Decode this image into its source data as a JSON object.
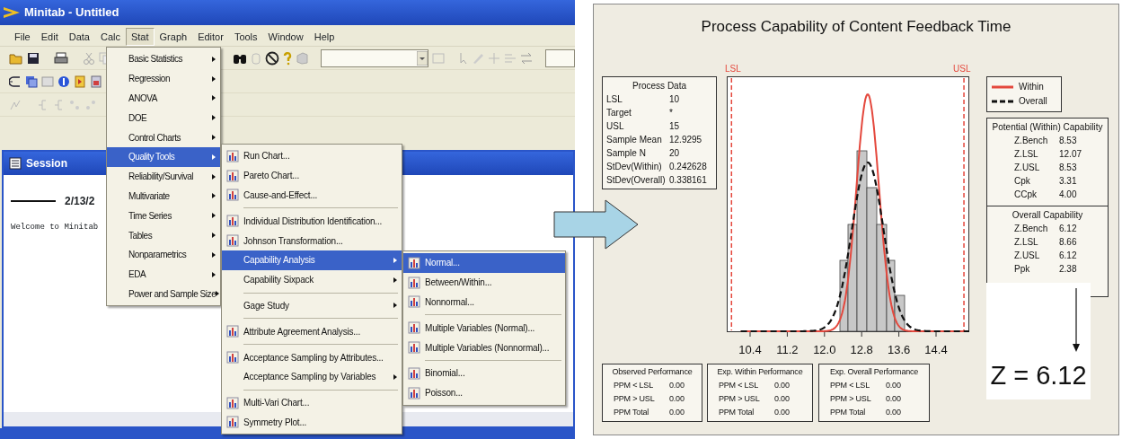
{
  "window": {
    "title": "Minitab - Untitled"
  },
  "menu_bar": [
    {
      "label": "File",
      "selected": false
    },
    {
      "label": "Edit",
      "selected": false
    },
    {
      "label": "Data",
      "selected": false
    },
    {
      "label": "Calc",
      "selected": false
    },
    {
      "label": "Stat",
      "selected": true
    },
    {
      "label": "Graph",
      "selected": false
    },
    {
      "label": "Editor",
      "selected": false
    },
    {
      "label": "Tools",
      "selected": false
    },
    {
      "label": "Window",
      "selected": false
    },
    {
      "label": "Help",
      "selected": false
    }
  ],
  "session": {
    "title": "Session",
    "date": "2/13/2",
    "welcome": "Welcome to Minitab"
  },
  "menus": [
    {
      "items": [
        {
          "label": "Basic Statistics",
          "kind": "plain",
          "submenu": true,
          "selected": false,
          "separator_before": false
        },
        {
          "label": "Regression",
          "kind": "plain",
          "submenu": true,
          "selected": false,
          "separator_before": false
        },
        {
          "label": "ANOVA",
          "kind": "plain",
          "submenu": true,
          "selected": false,
          "separator_before": false
        },
        {
          "label": "DOE",
          "kind": "plain",
          "submenu": true,
          "selected": false,
          "separator_before": false
        },
        {
          "label": "Control Charts",
          "kind": "plain",
          "submenu": true,
          "selected": false,
          "separator_before": false
        },
        {
          "label": "Quality Tools",
          "kind": "plain",
          "submenu": true,
          "selected": true,
          "separator_before": false
        },
        {
          "label": "Reliability/Survival",
          "kind": "plain",
          "submenu": true,
          "selected": false,
          "separator_before": false
        },
        {
          "label": "Multivariate",
          "kind": "plain",
          "submenu": true,
          "selected": false,
          "separator_before": false
        },
        {
          "label": "Time Series",
          "kind": "plain",
          "submenu": true,
          "selected": false,
          "separator_before": false
        },
        {
          "label": "Tables",
          "kind": "plain",
          "submenu": true,
          "selected": false,
          "separator_before": false
        },
        {
          "label": "Nonparametrics",
          "kind": "plain",
          "submenu": true,
          "selected": false,
          "separator_before": false
        },
        {
          "label": "EDA",
          "kind": "plain",
          "submenu": true,
          "selected": false,
          "separator_before": false
        },
        {
          "label": "Power and Sample Size",
          "kind": "plain",
          "submenu": true,
          "selected": false,
          "separator_before": false
        }
      ]
    },
    {
      "items": [
        {
          "label": "Run Chart...",
          "kind": "icon",
          "submenu": false,
          "selected": false,
          "separator_before": false
        },
        {
          "label": "Pareto Chart...",
          "kind": "icon",
          "submenu": false,
          "selected": false,
          "separator_before": false
        },
        {
          "label": "Cause-and-Effect...",
          "kind": "icon",
          "submenu": false,
          "selected": false,
          "separator_before": false
        },
        {
          "label": "Individual Distribution Identification...",
          "kind": "icon",
          "submenu": false,
          "selected": false,
          "separator_before": true
        },
        {
          "label": "Johnson Transformation...",
          "kind": "icon",
          "submenu": false,
          "selected": false,
          "separator_before": false
        },
        {
          "label": "Capability Analysis",
          "kind": "plain",
          "submenu": true,
          "selected": true,
          "separator_before": false
        },
        {
          "label": "Capability Sixpack",
          "kind": "plain",
          "submenu": true,
          "selected": false,
          "separator_before": false
        },
        {
          "label": "Gage Study",
          "kind": "plain",
          "submenu": true,
          "selected": false,
          "separator_before": true
        },
        {
          "label": "Attribute Agreement Analysis...",
          "kind": "icon",
          "submenu": false,
          "selected": false,
          "separator_before": true
        },
        {
          "label": "Acceptance Sampling by Attributes...",
          "kind": "icon",
          "submenu": false,
          "selected": false,
          "separator_before": true
        },
        {
          "label": "Acceptance Sampling by Variables",
          "kind": "plain",
          "submenu": true,
          "selected": false,
          "separator_before": false
        },
        {
          "label": "Multi-Vari Chart...",
          "kind": "icon",
          "submenu": false,
          "selected": false,
          "separator_before": true
        },
        {
          "label": "Symmetry Plot...",
          "kind": "icon",
          "submenu": false,
          "selected": false,
          "separator_before": false
        }
      ]
    },
    {
      "items": [
        {
          "label": "Normal...",
          "kind": "icon",
          "submenu": false,
          "selected": true,
          "separator_before": false
        },
        {
          "label": "Between/Within...",
          "kind": "icon",
          "submenu": false,
          "selected": false,
          "separator_before": false
        },
        {
          "label": "Nonnormal...",
          "kind": "icon",
          "submenu": false,
          "selected": false,
          "separator_before": false
        },
        {
          "label": "Multiple Variables (Normal)...",
          "kind": "icon",
          "submenu": false,
          "selected": false,
          "separator_before": true
        },
        {
          "label": "Multiple Variables (Nonnormal)...",
          "kind": "icon",
          "submenu": false,
          "selected": false,
          "separator_before": false
        },
        {
          "label": "Binomial...",
          "kind": "icon",
          "submenu": false,
          "selected": false,
          "separator_before": true
        },
        {
          "label": "Poisson...",
          "kind": "icon",
          "submenu": false,
          "selected": false,
          "separator_before": false
        }
      ]
    }
  ],
  "graph": {
    "title": "Process Capability of Content Feedback Time",
    "spec_labels": [
      "LSL",
      "USL"
    ],
    "process_data": {
      "title": "Process Data",
      "rows": [
        {
          "label": "LSL",
          "value": "10"
        },
        {
          "label": "Target",
          "value": "*"
        },
        {
          "label": "USL",
          "value": "15"
        },
        {
          "label": "Sample Mean",
          "value": "12.9295"
        },
        {
          "label": "Sample N",
          "value": "20"
        },
        {
          "label": "StDev(Within)",
          "value": "0.242628"
        },
        {
          "label": "StDev(Overall)",
          "value": "0.338161"
        }
      ]
    },
    "legend": [
      {
        "label": "Within",
        "kind": "solid"
      },
      {
        "label": "Overall",
        "kind": "dashed"
      }
    ],
    "potential": {
      "title": "Potential (Within) Capability",
      "rows": [
        {
          "label": "Z.Bench",
          "value": "8.53"
        },
        {
          "label": "Z.LSL",
          "value": "12.07"
        },
        {
          "label": "Z.USL",
          "value": "8.53"
        },
        {
          "label": "Cpk",
          "value": "3.31"
        },
        {
          "label": "CCpk",
          "value": "4.00"
        }
      ]
    },
    "overall": {
      "title": "Overall Capability",
      "rows": [
        {
          "label": "Z.Bench",
          "value": "6.12"
        },
        {
          "label": "Z.LSL",
          "value": "8.66"
        },
        {
          "label": "Z.USL",
          "value": "6.12"
        },
        {
          "label": "Ppk",
          "value": "2.38"
        }
      ]
    },
    "x_ticks": [
      "10.4",
      "11.2",
      "12.0",
      "12.8",
      "13.6",
      "14.4"
    ],
    "performance": [
      {
        "title": "Observed Performance",
        "rows": [
          {
            "label": "PPM < LSL",
            "value": "0.00"
          },
          {
            "label": "PPM > USL",
            "value": "0.00"
          },
          {
            "label": "PPM Total",
            "value": "0.00"
          }
        ]
      },
      {
        "title": "Exp. Within Performance",
        "rows": [
          {
            "label": "PPM < LSL",
            "value": "0.00"
          },
          {
            "label": "PPM > USL",
            "value": "0.00"
          },
          {
            "label": "PPM Total",
            "value": "0.00"
          }
        ]
      },
      {
        "title": "Exp. Overall Performance",
        "rows": [
          {
            "label": "PPM < LSL",
            "value": "0.00"
          },
          {
            "label": "PPM > USL",
            "value": "0.00"
          },
          {
            "label": "PPM Total",
            "value": "0.00"
          }
        ]
      }
    ],
    "callout": "Z = 6.12"
  }
}
